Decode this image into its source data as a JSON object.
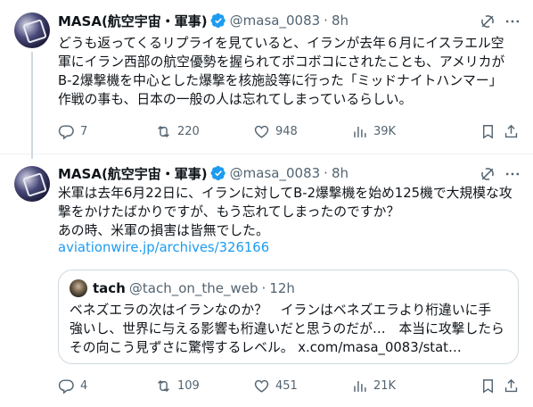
{
  "tweets": [
    {
      "author": {
        "name": "MASA(航空宇宙・軍事)",
        "handle": "@masa_0083"
      },
      "separator": "·",
      "time": "8h",
      "text": "どうも返ってくるリプライを見ていると、イランが去年６月にイスラエル空\n軍にイラン西部の航空優勢を握られてボコボコにされたことも、アメリカが\nB-2爆撃機を中心とした爆撃を核施設等に行った「ミッドナイトハンマー」\n作戦の事も、日本の一般の人は忘れてしまっているらしい。",
      "stats": {
        "replies": "7",
        "reposts": "220",
        "likes": "948",
        "views": "39K"
      }
    },
    {
      "author": {
        "name": "MASA(航空宇宙・軍事)",
        "handle": "@masa_0083"
      },
      "separator": "·",
      "time": "8h",
      "text": "米軍は去年6月22日に、イランに対してB-2爆撃機を始め125機で大規模な攻\n撃をかけたばかりですが、もう忘れてしまったのですか？\nあの時、米軍の損害は皆無でした。",
      "link": "aviationwire.jp/archives/326166",
      "quote": {
        "name": "tach",
        "handle": "@tach_on_the_web",
        "separator": "·",
        "time": "12h",
        "text": "ベネズエラの次はイランなのか？　イランはベネズエラより桁違いに手\n強いし、世界に与える影響も桁違いだと思うのだが…　本当に攻撃したら\nその向こう見ずさに驚愕するレベル。 x.com/masa_0083/stat…"
      },
      "stats": {
        "replies": "4",
        "reposts": "109",
        "likes": "451",
        "views": "21K"
      }
    }
  ],
  "colors": {
    "accent": "#1d9bf0",
    "secondary_text": "#536471",
    "verified": "#1d9bf0",
    "border": "#cfd9de"
  },
  "icons": [
    "grok-icon",
    "more-icon",
    "verified-badge-icon",
    "reply-icon",
    "repost-icon",
    "like-icon",
    "views-icon",
    "bookmark-icon",
    "share-icon"
  ]
}
